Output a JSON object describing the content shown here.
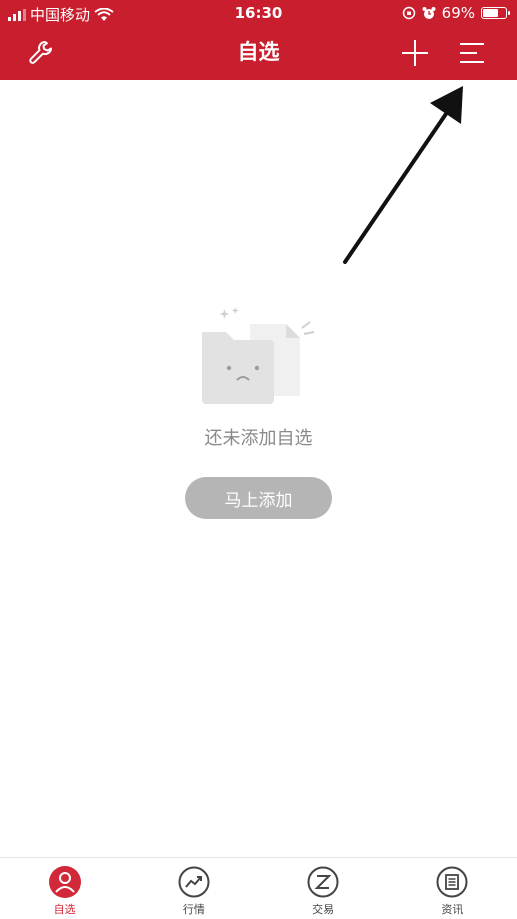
{
  "status_bar": {
    "carrier": "中国移动",
    "time": "16:30",
    "battery_percent": "69%",
    "battery_level": 0.69,
    "icons": [
      "signal-icon",
      "wifi-icon",
      "rotation-lock-icon",
      "alarm-icon",
      "battery-icon"
    ]
  },
  "header": {
    "title": "自选",
    "left_icon": "wrench-icon",
    "right_icons": [
      "plus-icon",
      "menu-lines-icon"
    ],
    "background_color": "#c81e2e"
  },
  "empty_state": {
    "message": "还未添加自选",
    "button_label": "马上添加",
    "illustration": "empty-folder-icon"
  },
  "annotation": {
    "type": "arrow",
    "target": "menu-lines-icon",
    "color": "#111111"
  },
  "bottom_nav": {
    "items": [
      {
        "label": "自选",
        "icon": "user-circle-icon",
        "active": true
      },
      {
        "label": "行情",
        "icon": "trend-chart-icon",
        "active": false
      },
      {
        "label": "交易",
        "icon": "trade-z-icon",
        "active": false
      },
      {
        "label": "资讯",
        "icon": "news-icon",
        "active": false
      }
    ],
    "active_color": "#d1293a"
  }
}
